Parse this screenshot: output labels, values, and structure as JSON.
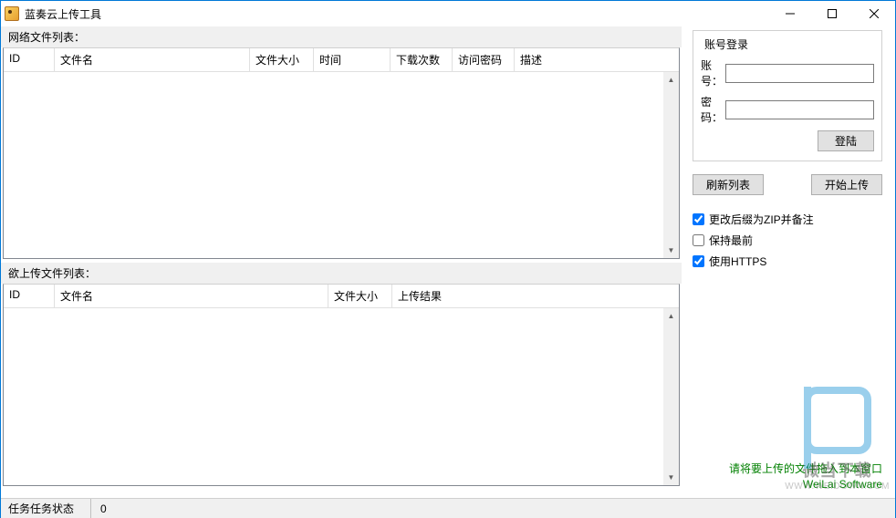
{
  "window": {
    "title": "蓝奏云上传工具"
  },
  "leftPanel": {
    "networkListLabel": "网络文件列表：",
    "networkListCols": {
      "id": "ID",
      "name": "文件名",
      "size": "文件大小",
      "time": "时间",
      "downloads": "下载次数",
      "password": "访问密码",
      "desc": "描述"
    },
    "uploadListLabel": "欲上传文件列表：",
    "uploadListCols": {
      "id": "ID",
      "name": "文件名",
      "size": "文件大小",
      "result": "上传结果"
    }
  },
  "loginBox": {
    "title": "账号登录",
    "accountLabel": "账号：",
    "accountValue": "",
    "passwordLabel": "密码：",
    "passwordValue": "",
    "loginBtn": "登陆"
  },
  "actions": {
    "refresh": "刷新列表",
    "startUpload": "开始上传"
  },
  "options": {
    "zipRemark": {
      "label": "更改后缀为ZIP并备注",
      "checked": true
    },
    "keepOnTop": {
      "label": "保持最前",
      "checked": false
    },
    "useHttps": {
      "label": "使用HTTPS",
      "checked": true
    }
  },
  "footerText": {
    "hint": "请将要上传的文件拖入到本窗口",
    "brand": "WeiLai Software"
  },
  "statusbar": {
    "label": "任务任务状态",
    "value": "0"
  },
  "watermark": {
    "label": "微当下载",
    "url": "WWW.WEIDOWN.COM"
  }
}
